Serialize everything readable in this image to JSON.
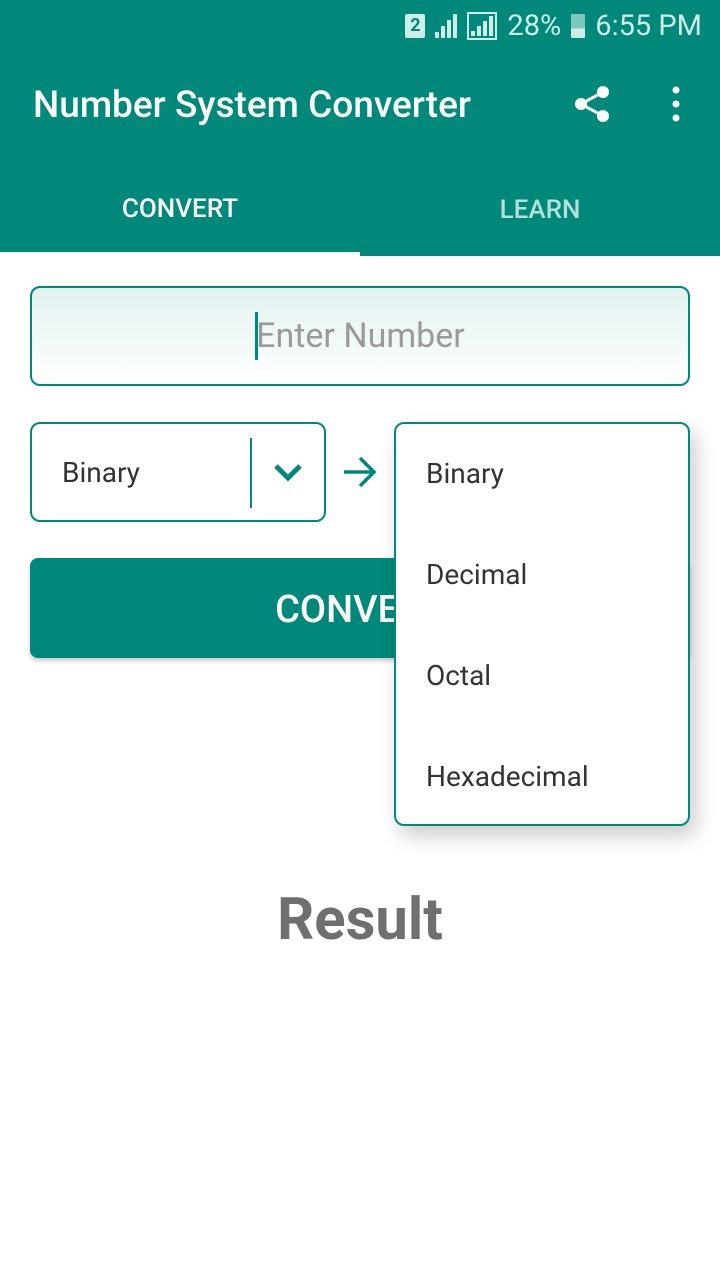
{
  "status_bar": {
    "sim": "2",
    "battery": "28%",
    "time": "6:55 PM"
  },
  "app_bar": {
    "title": "Number System Converter",
    "share_icon": "share-icon",
    "more_icon": "more-vert-icon"
  },
  "tabs": [
    {
      "label": "CONVERT",
      "selected": true
    },
    {
      "label": "LEARN",
      "selected": false
    }
  ],
  "number_input": {
    "placeholder": "Enter Number",
    "value": ""
  },
  "from_select": {
    "value": "Binary"
  },
  "to_select": {
    "options": [
      "Binary",
      "Decimal",
      "Octal",
      "Hexadecimal"
    ],
    "open": true
  },
  "convert_button": {
    "label": "CONVERT"
  },
  "result": {
    "label": "Result"
  },
  "colors": {
    "primary": "#00897b"
  }
}
